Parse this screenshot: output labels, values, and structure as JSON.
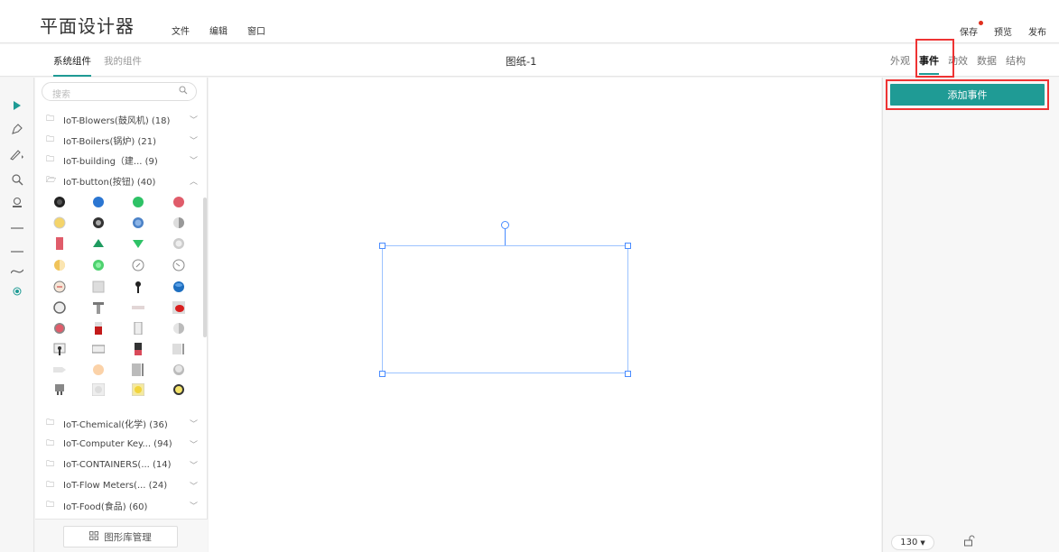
{
  "app": {
    "title": "平面设计器"
  },
  "menu": [
    "文件",
    "编辑",
    "窗口"
  ],
  "top_actions": {
    "save": "保存",
    "preview": "预览",
    "publish": "发布"
  },
  "library": {
    "tabs": [
      "系统组件",
      "我的组件"
    ],
    "search_placeholder": "搜索",
    "categories_top": [
      "IoT-Blowers(鼓风机) (18)",
      "IoT-Boilers(锅炉) (21)",
      "IoT-building（建... (9)",
      "IoT-button(按钮) (40)"
    ],
    "categories_bottom": [
      "IoT-Chemical(化学) (36)",
      "IoT-Computer Key... (94)",
      "IoT-CONTAINERS(... (14)",
      "IoT-Flow Meters(... (24)",
      "IoT-Food(食品) (60)"
    ],
    "manage_label": "图形库管理"
  },
  "canvas": {
    "title": "图纸-1"
  },
  "properties": {
    "tabs": [
      "外观",
      "事件",
      "动效",
      "数据",
      "结构"
    ],
    "active_tab": "事件",
    "add_event_label": "添加事件"
  },
  "statusbar": {
    "zoom": "130"
  },
  "colors": {
    "accent": "#1f9b95",
    "highlight": "#e33333",
    "selection": "#4a8cff"
  }
}
